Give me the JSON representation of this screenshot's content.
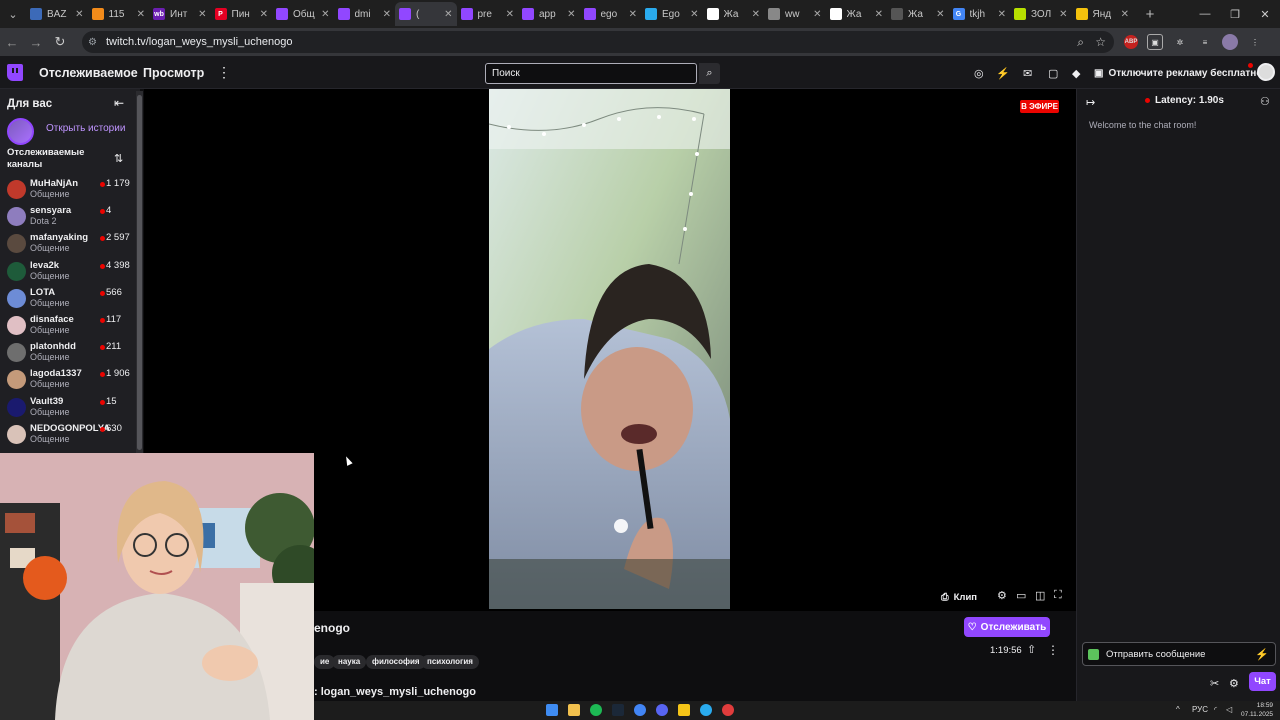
{
  "browser": {
    "tabs": [
      {
        "title": "BAZ",
        "fav_color": "#3c6ab8",
        "fav_text": "",
        "active": false
      },
      {
        "title": "115",
        "fav_color": "#f28b1a",
        "fav_text": "",
        "active": false
      },
      {
        "title": "Инт",
        "fav_color": "#6b1fb1",
        "fav_text": "wb",
        "active": false
      },
      {
        "title": "Пин",
        "fav_color": "#e60023",
        "fav_text": "P",
        "active": false
      },
      {
        "title": "Общ",
        "fav_color": "#9147ff",
        "fav_text": "",
        "active": false
      },
      {
        "title": "dmi",
        "fav_color": "#9147ff",
        "fav_text": "",
        "active": false
      },
      {
        "title": "(",
        "fav_color": "#9147ff",
        "fav_text": "",
        "active": true
      },
      {
        "title": "pre",
        "fav_color": "#9147ff",
        "fav_text": "",
        "active": false
      },
      {
        "title": "app",
        "fav_color": "#9147ff",
        "fav_text": "",
        "active": false
      },
      {
        "title": "ego",
        "fav_color": "#9147ff",
        "fav_text": "",
        "active": false
      },
      {
        "title": "Ego",
        "fav_color": "#2aabee",
        "fav_text": "",
        "active": false
      },
      {
        "title": "Жа",
        "fav_color": "#ffffff",
        "fav_text": "",
        "active": false
      },
      {
        "title": "ww",
        "fav_color": "#888888",
        "fav_text": "",
        "active": false
      },
      {
        "title": "Жа",
        "fav_color": "#ffffff",
        "fav_text": "",
        "active": false
      },
      {
        "title": "Жа",
        "fav_color": "#555555",
        "fav_text": "",
        "active": false
      },
      {
        "title": "tkjh",
        "fav_color": "#4285f4",
        "fav_text": "G",
        "active": false
      },
      {
        "title": "ЗОЛ",
        "fav_color": "#b7e000",
        "fav_text": "",
        "active": false
      },
      {
        "title": "Янд",
        "fav_color": "#f4c20d",
        "fav_text": "",
        "active": false
      }
    ],
    "url": "twitch.tv/logan_weys_mysli_uchenogo",
    "ext_abp": "ABP"
  },
  "topnav": {
    "following": "Отслеживаемое",
    "browse": "Просмотр",
    "search_placeholder": "Поиск",
    "promo": "Отключите рекламу бесплатно"
  },
  "sidebar": {
    "heading": "Для вас",
    "stories": "Открыть истории",
    "followed_label": "Отслеживаемые каналы",
    "channels": [
      {
        "name": "MuHaNjAn",
        "category": "Общение",
        "viewers": "1 179",
        "color": "#c0392b"
      },
      {
        "name": "sensyara",
        "category": "Dota 2",
        "viewers": "4",
        "color": "#8e7dbe"
      },
      {
        "name": "mafanyaking",
        "category": "Общение",
        "viewers": "2 597",
        "color": "#5a4a3f"
      },
      {
        "name": "leva2k",
        "category": "Общение",
        "viewers": "4 398",
        "color": "#1e5b3a"
      },
      {
        "name": "LOTA",
        "category": "Общение",
        "viewers": "566",
        "color": "#6d8cd6"
      },
      {
        "name": "disnaface",
        "category": "Общение",
        "viewers": "117",
        "color": "#e0bfc4"
      },
      {
        "name": "platonhdd",
        "category": "Общение",
        "viewers": "211",
        "color": "#6e6e6e"
      },
      {
        "name": "lagoda1337",
        "category": "Общение",
        "viewers": "1 906",
        "color": "#c49a7a"
      },
      {
        "name": "Vault39",
        "category": "Общение",
        "viewers": "15",
        "color": "#1a1a6e"
      },
      {
        "name": "NEDOGONPOLYA",
        "category": "Общение",
        "viewers": "630",
        "color": "#d9c2b8"
      }
    ]
  },
  "player": {
    "live_badge": "В ЭФИРЕ",
    "clip_label": "Клип"
  },
  "info": {
    "title_fragment": "enogo",
    "tags": [
      "ие",
      "наука",
      "философия",
      "психология"
    ],
    "follow_label": "Отслеживать",
    "uptime": "1:19:56",
    "bottom_text": ": logan_weys_mysli_uchenogo"
  },
  "chat": {
    "latency": "Latency: 1.90s",
    "welcome": "Welcome to the chat room!",
    "input_placeholder": "Отправить сообщение",
    "send_label": "Чат"
  },
  "taskbar": {
    "lang": "РУС",
    "time": "18:59",
    "date": "07.11.2025"
  },
  "colors": {
    "accent": "#9147ff",
    "live": "#eb0400",
    "background": "#0e0e10"
  }
}
